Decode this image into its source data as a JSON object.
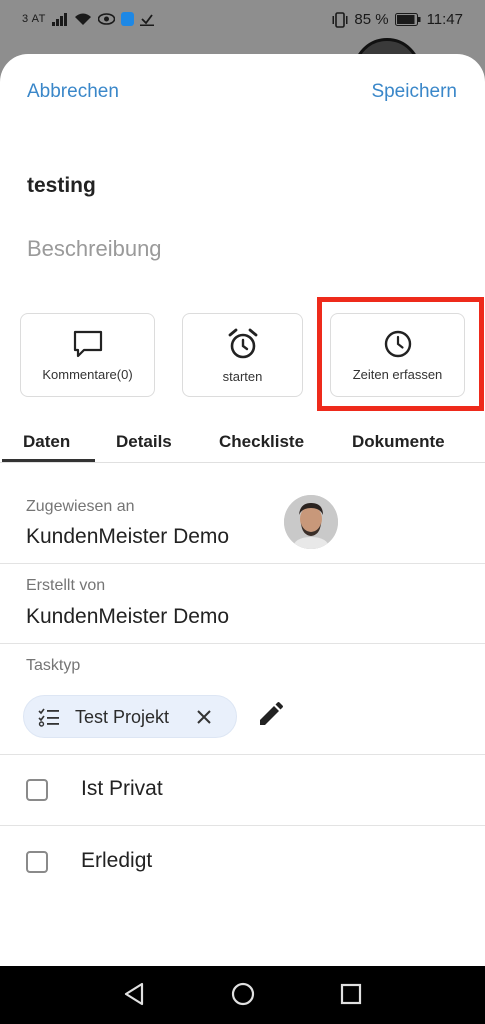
{
  "status_bar": {
    "carrier": "3 AT",
    "battery": "85 %",
    "time": "11:47"
  },
  "header": {
    "cancel": "Abbrechen",
    "save": "Speichern"
  },
  "task": {
    "title": "testing",
    "description_placeholder": "Beschreibung"
  },
  "action_cards": [
    {
      "label": "Kommentare(0)",
      "icon": "comment-icon"
    },
    {
      "label": "starten",
      "icon": "alarm-clock-icon"
    },
    {
      "label": "Zeiten erfassen",
      "icon": "clock-icon"
    }
  ],
  "tabs": [
    "Daten",
    "Details",
    "Checkliste",
    "Dokumente"
  ],
  "fields": {
    "assigned_label": "Zugewiesen an",
    "assigned_value": "KundenMeister Demo",
    "created_label": "Erstellt von",
    "created_value": "KundenMeister Demo",
    "tasktype_label": "Tasktyp",
    "tasktype_chip": "Test Projekt"
  },
  "checkboxes": [
    {
      "label": "Ist Privat",
      "checked": false
    },
    {
      "label": "Erledigt",
      "checked": false
    }
  ],
  "colors": {
    "link": "#3a87c9",
    "highlight": "#ee2a1b",
    "chip_bg": "#e9f0fb"
  }
}
